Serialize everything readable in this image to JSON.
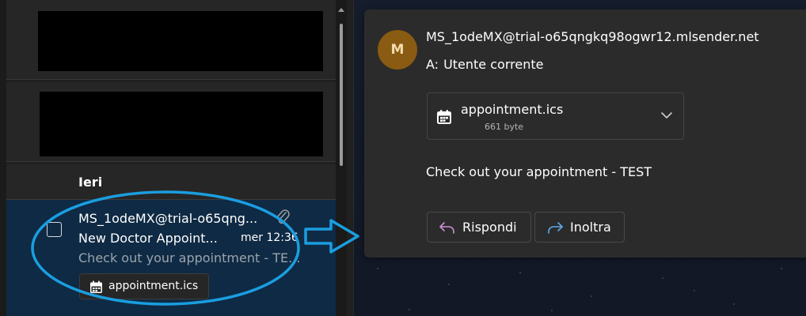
{
  "mail_list": {
    "date_header": "Ieri",
    "selected_message": {
      "sender": "MS_1odeMX@trial-o65qng...",
      "subject": "New Doctor Appoint...",
      "time": "mer 12:36",
      "preview": "Check out your appointment - TE...",
      "attachment_name": "appointment.ics",
      "attachment_icon": "calendar-icon",
      "has_attachment_icon": "paperclip-icon"
    }
  },
  "reading_pane": {
    "avatar_initial": "M",
    "avatar_color": "#8a5b12",
    "sender": "MS_1odeMX@trial-o65qngkq98ogwr12.mlsender.net",
    "to_label": "A:",
    "to_name": "Utente corrente",
    "attachment": {
      "name": "appointment.ics",
      "size": "661 byte",
      "icon": "calendar-icon"
    },
    "body": "Check out your appointment - TEST",
    "reply_label": "Rispondi",
    "forward_label": "Inoltra"
  },
  "colors": {
    "selected_row": "#0f2a44",
    "annotation": "#1a9ee0",
    "reply_icon": "#c98fd6",
    "forward_icon": "#5fa8e8"
  }
}
